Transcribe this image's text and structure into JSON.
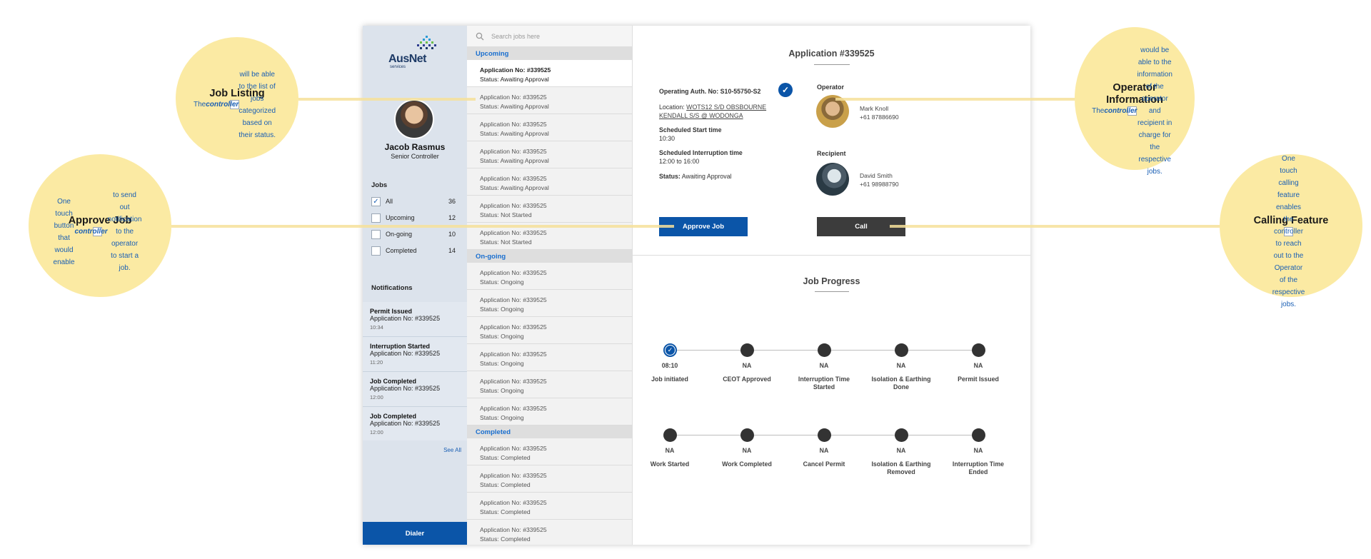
{
  "callouts": {
    "job_listing": {
      "title": "Job Listing",
      "pre": "The ",
      "bold": "controller",
      "post": " will be able to the list of jobs categorized based on their status."
    },
    "approve_job": {
      "title": "Approve Job",
      "pre": "One touch button that would enable ",
      "bold": "controller",
      "post": " to send out notification to the operator to start a job."
    },
    "operator_info": {
      "title": "Operator Information",
      "pre": "The ",
      "bold": "controller",
      "post": " would be able to the information of the operator and recipient in charge for the respective jobs."
    },
    "calling_feature": {
      "title": "Calling Feature",
      "pre": "",
      "bold": "",
      "post": "One touch calling feature enables the controller to reach out to the Operator of the respective jobs."
    }
  },
  "sidebar": {
    "brand": "AusNet",
    "brand_sub": "services",
    "user_name": "Jacob Rasmus",
    "user_role": "Senior Controller",
    "jobs_title": "Jobs",
    "filters": [
      {
        "label": "All",
        "count": "36",
        "checked": true
      },
      {
        "label": "Upcoming",
        "count": "12",
        "checked": false
      },
      {
        "label": "On-going",
        "count": "10",
        "checked": false
      },
      {
        "label": "Completed",
        "count": "14",
        "checked": false
      }
    ],
    "notifications_title": "Notifications",
    "notifications": [
      {
        "title": "Permit Issued",
        "app": "Application No: #339525",
        "time": "10:34"
      },
      {
        "title": "Interruption Started",
        "app": "Application No: #339525",
        "time": "11:20"
      },
      {
        "title": "Job Completed",
        "app": "Application No: #339525",
        "time": "12:00"
      },
      {
        "title": "Job Completed",
        "app": "Application No: #339525",
        "time": "12:00"
      }
    ],
    "see_all": "See All",
    "dialer": "Dialer"
  },
  "joblist": {
    "search_placeholder": "Search jobs here",
    "groups": [
      {
        "name": "Upcoming",
        "jobs": [
          {
            "no": "Application No: #339525",
            "status": "Status: Awaiting Approval",
            "active": true
          },
          {
            "no": "Application No: #339525",
            "status": "Status: Awaiting Approval"
          },
          {
            "no": "Application No: #339525",
            "status": "Status: Awaiting Approval"
          },
          {
            "no": "Application No: #339525",
            "status": "Status: Awaiting Approval"
          },
          {
            "no": "Application No: #339525",
            "status": "Status: Awaiting Approval"
          },
          {
            "no": "Application No: #339525",
            "status": "Status: Not Started"
          },
          {
            "no": "Application No: #339525",
            "status": "Status: Not Started"
          }
        ]
      },
      {
        "name": "On-going",
        "jobs": [
          {
            "no": "Application No: #339525",
            "status": "Status: Ongoing"
          },
          {
            "no": "Application No: #339525",
            "status": "Status: Ongoing"
          },
          {
            "no": "Application No: #339525",
            "status": "Status: Ongoing"
          },
          {
            "no": "Application No: #339525",
            "status": "Status: Ongoing"
          },
          {
            "no": "Application No: #339525",
            "status": "Status: Ongoing"
          },
          {
            "no": "Application No: #339525",
            "status": "Status: Ongoing"
          }
        ]
      },
      {
        "name": "Completed",
        "jobs": [
          {
            "no": "Application No: #339525",
            "status": "Status: Completed"
          },
          {
            "no": "Application No: #339525",
            "status": "Status: Completed"
          },
          {
            "no": "Application No: #339525",
            "status": "Status: Completed"
          },
          {
            "no": "Application No: #339525",
            "status": "Status: Completed"
          }
        ]
      }
    ]
  },
  "detail": {
    "title": "Application #339525",
    "auth_label": "Operating Auth. No: S10-55750-S2",
    "location_label": "Location: ",
    "location_line1": "WOTS12 S/D OBSBOURNE",
    "location_line2": "KENDALL S/S @ WODONGA",
    "start_label": "Scheduled Start time",
    "start_value": "10:30",
    "interrupt_label": "Scheduled Interruption time",
    "interrupt_value": "12:00 to 16:00",
    "status_label": "Status:",
    "status_value": " Awaiting Approval",
    "operator_header": "Operator",
    "operator_name": "Mark Knoll",
    "operator_phone": "+61 87886690",
    "recipient_header": "Recipient",
    "recipient_name": "David Smith",
    "recipient_phone": "+61 98988790",
    "approve_button": "Approve Job",
    "call_button": "Call",
    "progress_title": "Job Progress",
    "progress_row1": [
      {
        "value": "08:10",
        "name": "Job initiated",
        "done": true
      },
      {
        "value": "NA",
        "name": "CEOT Approved"
      },
      {
        "value": "NA",
        "name": "Interruption Time Started"
      },
      {
        "value": "NA",
        "name": "Isolation & Earthing Done"
      },
      {
        "value": "NA",
        "name": "Permit Issued"
      }
    ],
    "progress_row2": [
      {
        "value": "NA",
        "name": "Work Started"
      },
      {
        "value": "NA",
        "name": "Work Completed"
      },
      {
        "value": "NA",
        "name": "Cancel Permit"
      },
      {
        "value": "NA",
        "name": "Isolation & Earthing Removed"
      },
      {
        "value": "NA",
        "name": "Interruption Time Ended"
      }
    ]
  }
}
